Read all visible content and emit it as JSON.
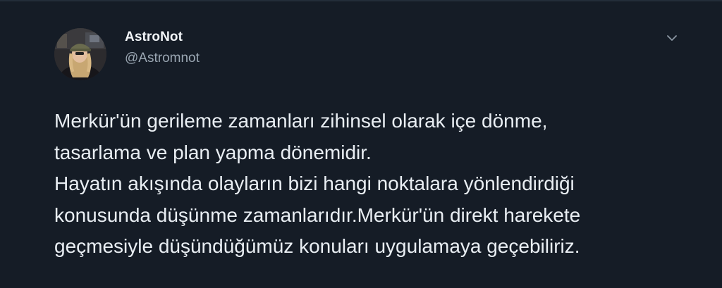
{
  "tweet": {
    "display_name": "AstroNot",
    "handle": "@Astromnot",
    "menu_icon": "chevron-down-icon",
    "avatar_icon": "user-avatar-photo",
    "text_lines": [
      "Merkür'ün gerileme zamanları zihinsel olarak içe dönme,",
      "tasarlama ve plan yapma dönemidir.",
      "Hayatın akışında olayların bizi hangi noktalara yönlendirdiği",
      "konusunda düşünme zamanlarıdır.Merkür'ün direkt harekete",
      "geçmesiyle düşündüğümüz konuları uygulamaya geçebiliriz."
    ]
  },
  "colors": {
    "background": "#151c26",
    "primary_text": "#e9eef3",
    "secondary_text": "#9aa6b2"
  }
}
